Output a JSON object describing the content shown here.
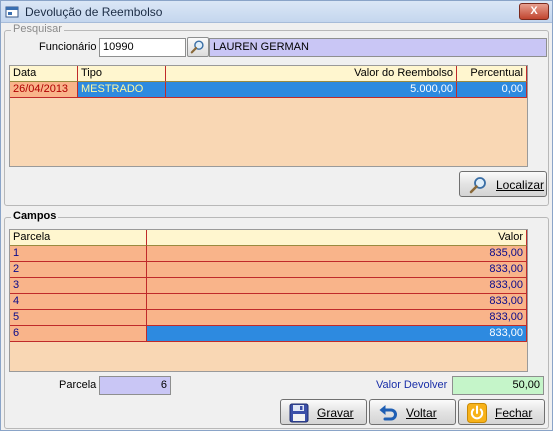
{
  "window": {
    "title": "Devolução de Reembolso",
    "close_label": "X"
  },
  "pesquisar": {
    "legend": "Pesquisar",
    "funcionario_label": "Funcionário",
    "funcionario_code": "10990",
    "funcionario_name": "LAUREN GERMAN",
    "table": {
      "headers": [
        "Data",
        "Tipo",
        "Valor do Reembolso",
        "Percentual"
      ],
      "rows": [
        {
          "data": "26/04/2013",
          "tipo": "MESTRADO",
          "valor": "5.000,00",
          "percentual": "0,00"
        }
      ]
    },
    "localizar_label": "Localizar"
  },
  "campos": {
    "legend": "Campos",
    "table": {
      "headers": [
        "Parcela",
        "Valor"
      ],
      "rows": [
        {
          "parcela": "1",
          "valor": "835,00"
        },
        {
          "parcela": "2",
          "valor": "833,00"
        },
        {
          "parcela": "3",
          "valor": "833,00"
        },
        {
          "parcela": "4",
          "valor": "833,00"
        },
        {
          "parcela": "5",
          "valor": "833,00"
        },
        {
          "parcela": "6",
          "valor": "833,00"
        }
      ]
    }
  },
  "footer": {
    "parcela_label": "Parcela",
    "parcela_value": "6",
    "valor_devolver_label": "Valor Devolver",
    "valor_devolver_value": "50,00",
    "gravar_label": "Gravar",
    "voltar_label": "Voltar",
    "fechar_label": "Fechar"
  },
  "colors": {
    "grid_background": "#f9d7b4",
    "row_peach": "#f9b48a",
    "row_selected": "#2d8ae0",
    "lavender_field": "#c9c6f5",
    "green_field": "#c5f5c9"
  },
  "icons": {
    "app": "app-icon",
    "search": "magnifier-icon",
    "localizar": "magnifier-icon",
    "gravar": "floppy-disk-icon",
    "voltar": "undo-arrow-icon",
    "fechar": "power-icon"
  }
}
